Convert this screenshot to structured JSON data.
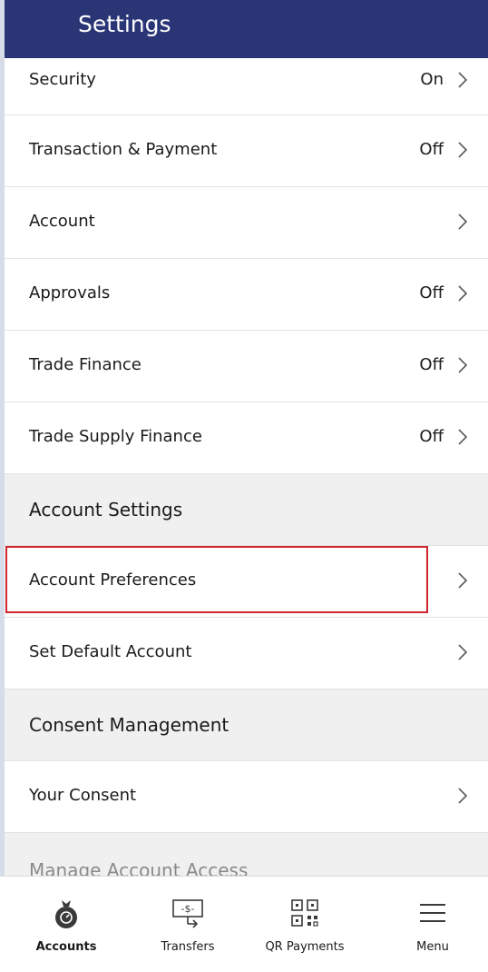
{
  "header": {
    "title": "Settings"
  },
  "rows": [
    {
      "label": "Security",
      "status": "On"
    },
    {
      "label": "Transaction & Payment",
      "status": "Off"
    },
    {
      "label": "Account",
      "status": ""
    },
    {
      "label": "Approvals",
      "status": "Off"
    },
    {
      "label": "Trade Finance",
      "status": "Off"
    },
    {
      "label": "Trade Supply Finance",
      "status": "Off"
    }
  ],
  "account_settings": {
    "heading": "Account Settings",
    "items": [
      {
        "label": "Account Preferences"
      },
      {
        "label": "Set Default Account"
      }
    ]
  },
  "consent_management": {
    "heading": "Consent Management",
    "items": [
      {
        "label": "Your Consent"
      }
    ]
  },
  "manage_access": {
    "heading": "Manage Account Access"
  },
  "tabbar": {
    "tabs": [
      {
        "label": "Accounts",
        "icon": "money-bag-icon",
        "active": true
      },
      {
        "label": "Transfers",
        "icon": "transfer-icon",
        "active": false
      },
      {
        "label": "QR Payments",
        "icon": "qr-code-icon",
        "active": false
      },
      {
        "label": "Menu",
        "icon": "hamburger-menu-icon",
        "active": false
      }
    ]
  },
  "colors": {
    "header_bg": "#2a3576",
    "highlight": "#d0262e",
    "section_bg": "#f0f0f0"
  }
}
